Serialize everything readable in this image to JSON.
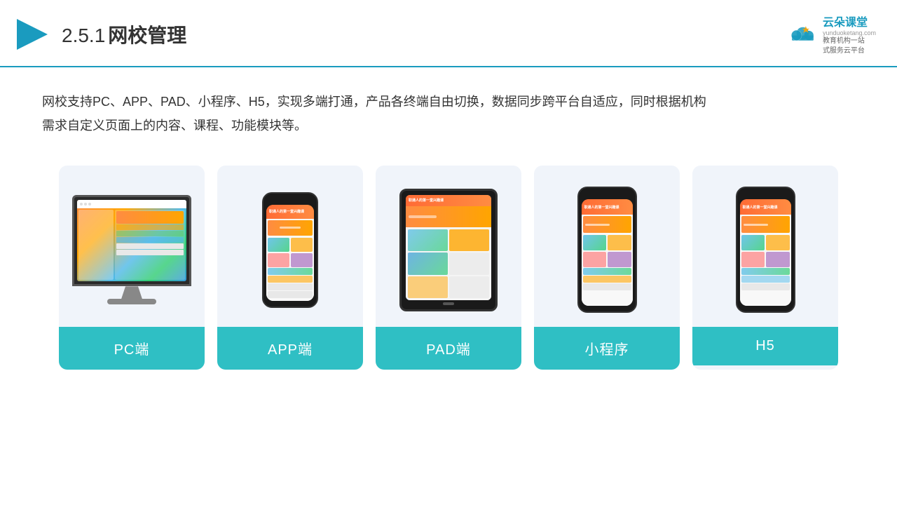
{
  "header": {
    "title": "网校管理",
    "title_num": "2.5.1",
    "logo_name": "云朵课堂",
    "logo_domain": "yunduoketang.com",
    "logo_tagline_line1": "教育机构一站",
    "logo_tagline_line2": "式服务云平台"
  },
  "description": {
    "text": "网校支持PC、APP、PAD、小程序、H5，实现多端打通，产品各终端自由切换，数据同步跨平台自适应，同时根据机构",
    "text2": "需求自定义页面上的内容、课程、功能模块等。"
  },
  "devices": [
    {
      "id": "pc",
      "label": "PC端"
    },
    {
      "id": "app",
      "label": "APP端"
    },
    {
      "id": "pad",
      "label": "PAD端"
    },
    {
      "id": "miniprogram",
      "label": "小程序"
    },
    {
      "id": "h5",
      "label": "H5"
    }
  ],
  "colors": {
    "accent": "#2fbfc4",
    "header_border": "#1a9bbf",
    "title_color": "#333333",
    "card_bg": "#eef2f8",
    "text_color": "#333333"
  }
}
